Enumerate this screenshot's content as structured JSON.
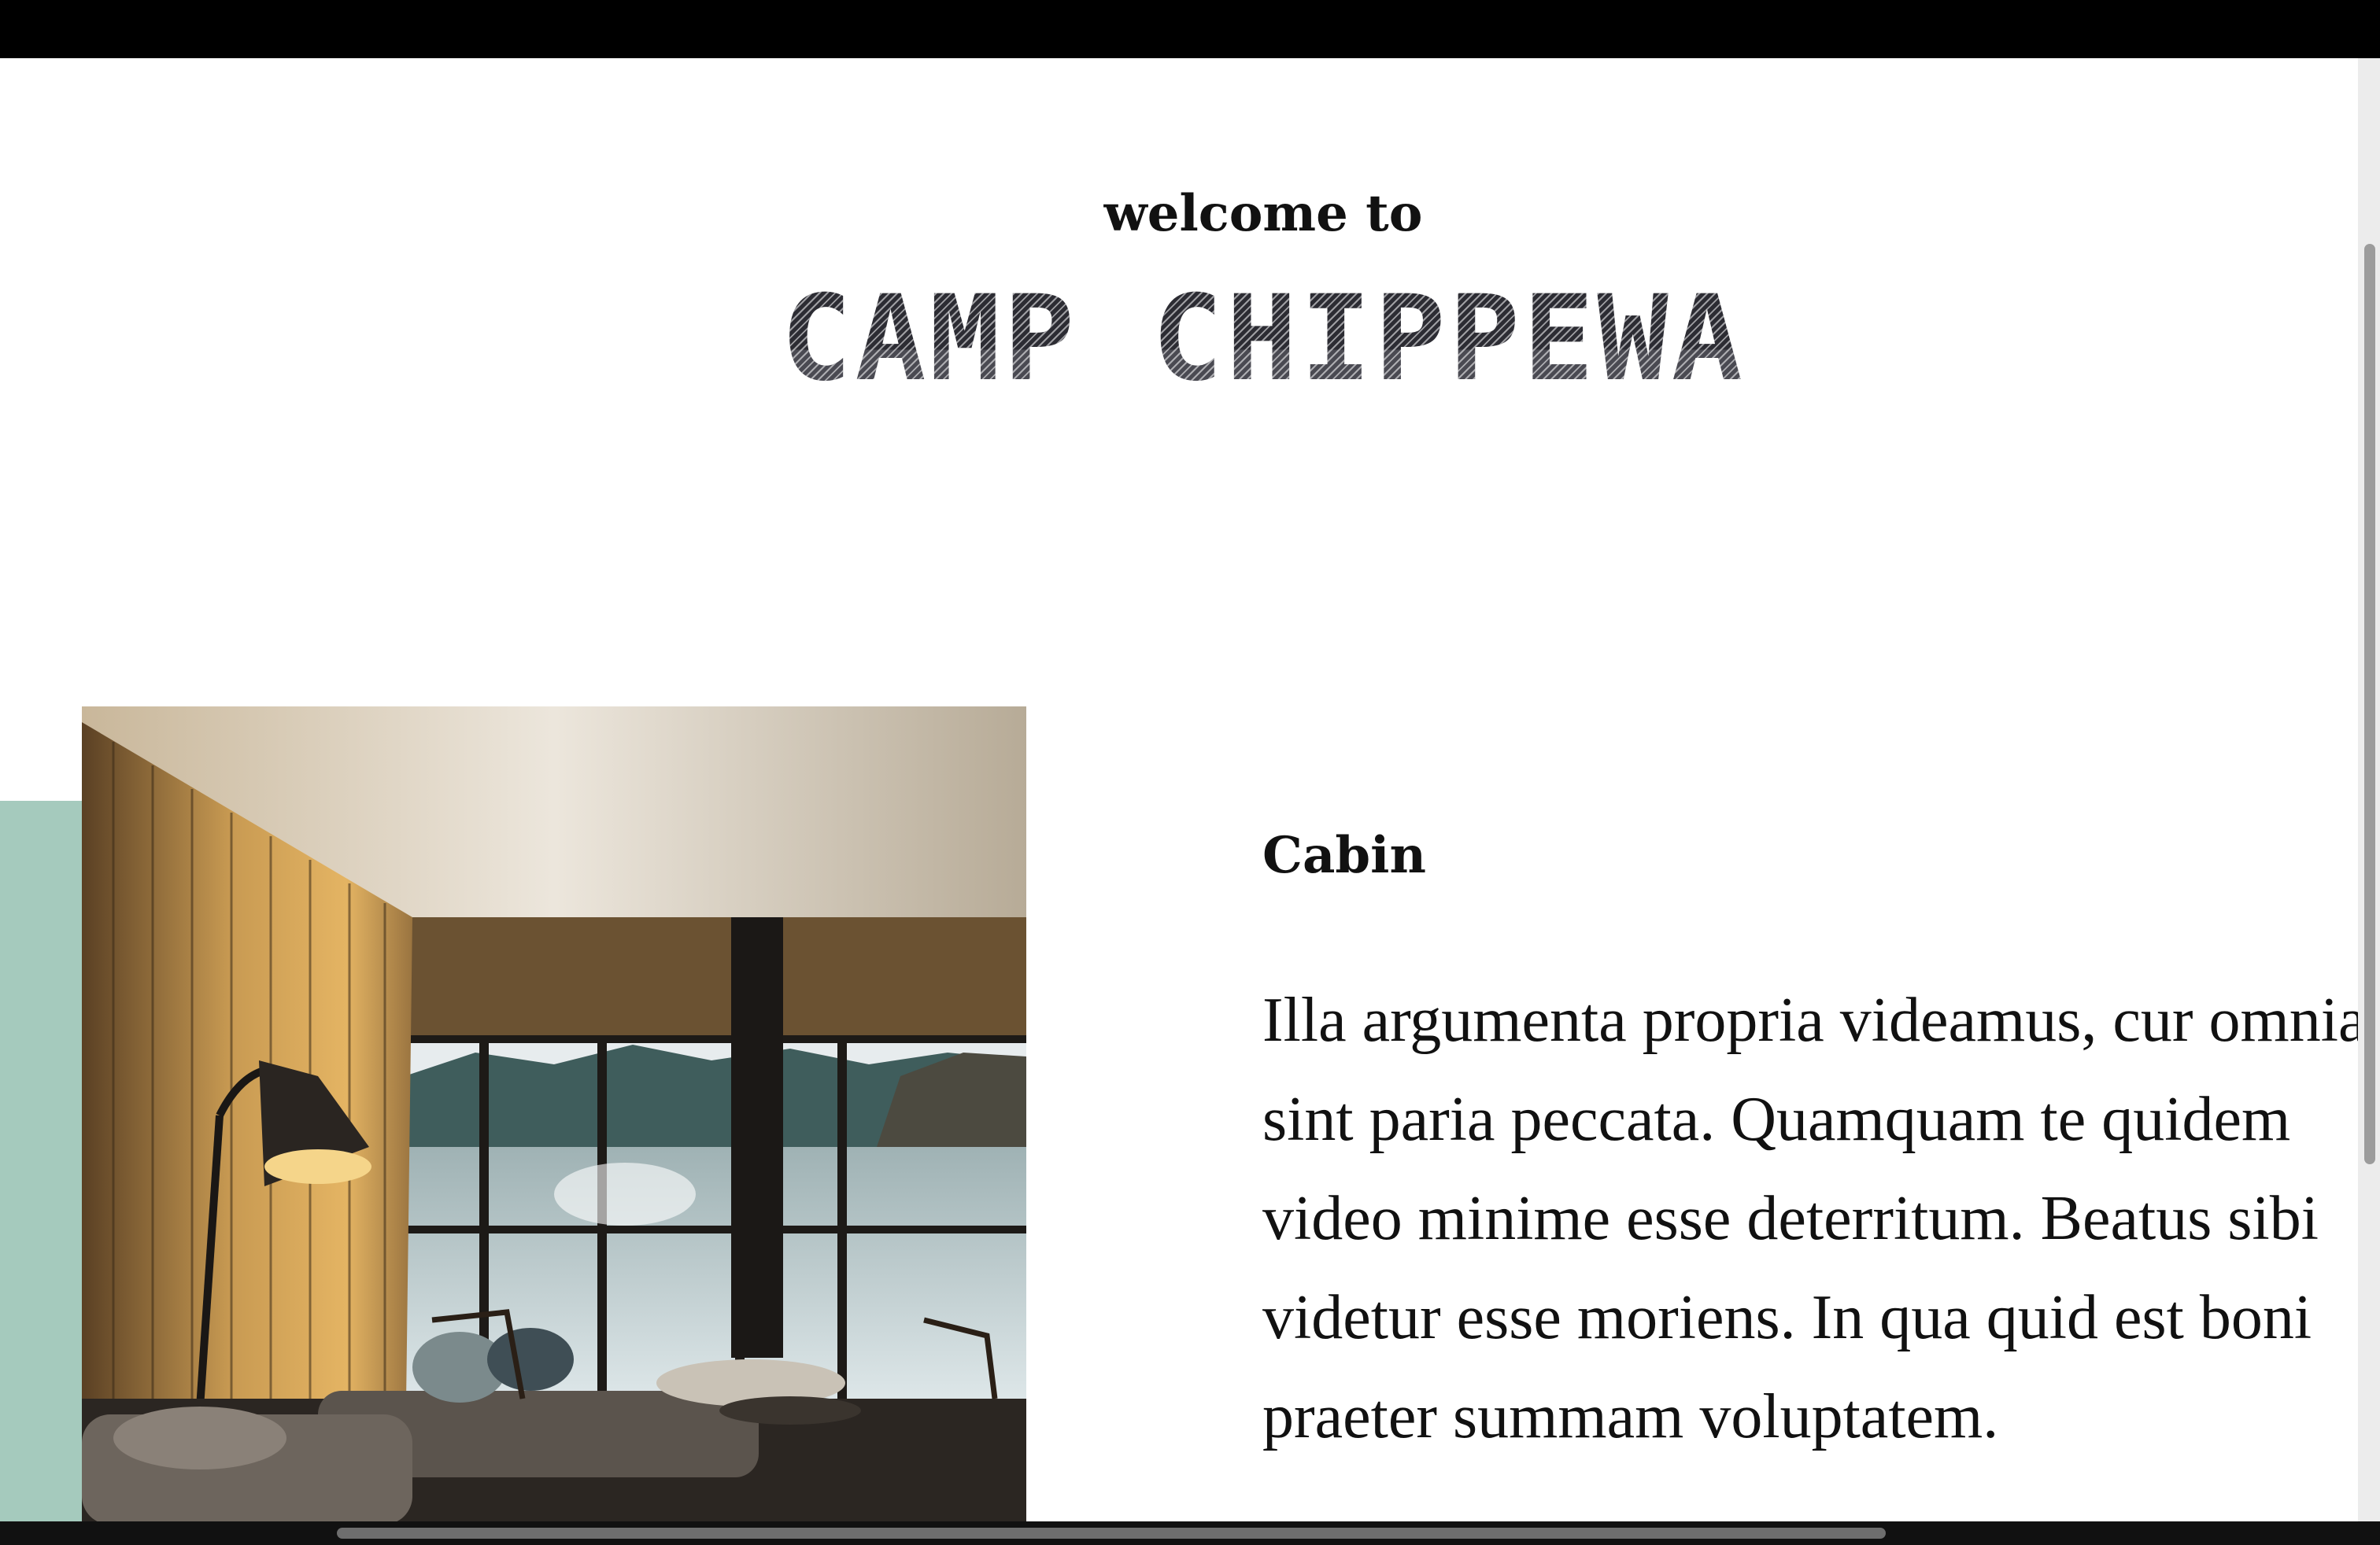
{
  "hero": {
    "welcome": "welcome to",
    "title": "CAMP CHIPPEWA"
  },
  "section": {
    "image_alt": "Cabin interior with wood-panelled wall, floor lamp, sofa and floor-to-ceiling windows overlooking a lake",
    "heading": "Cabin",
    "body_lines": [
      "Illa argumenta propria videamus, cur omnia",
      "sint paria peccata. Quamquam te quidem",
      "video minime esse deterritum. Beatus sibi",
      "videtur esse moriens. In qua quid est boni",
      "praeter summam voluptatem."
    ]
  },
  "colors": {
    "accent": "#a5cabd",
    "title": "#2c2c33",
    "text": "#111111",
    "background": "#ffffff"
  }
}
